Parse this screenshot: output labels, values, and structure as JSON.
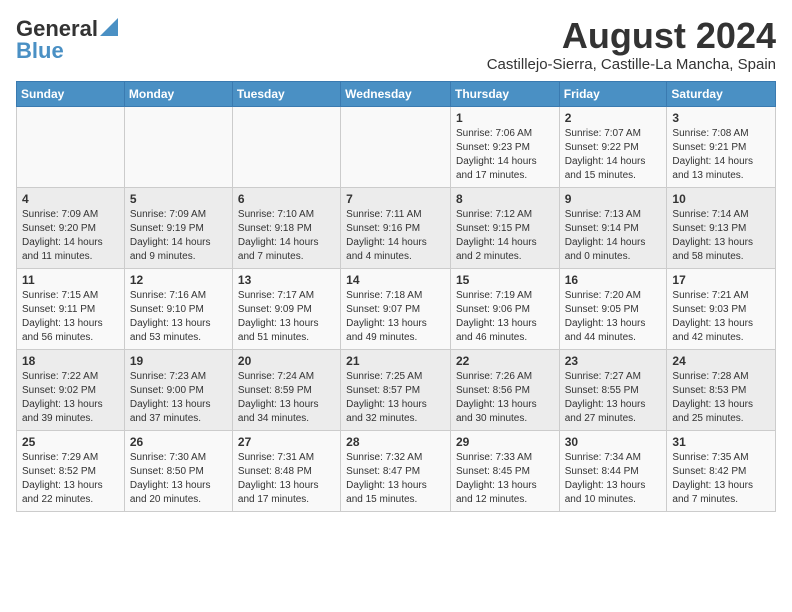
{
  "header": {
    "logo_general": "General",
    "logo_blue": "Blue",
    "month": "August 2024",
    "location": "Castillejo-Sierra, Castille-La Mancha, Spain"
  },
  "days_of_week": [
    "Sunday",
    "Monday",
    "Tuesday",
    "Wednesday",
    "Thursday",
    "Friday",
    "Saturday"
  ],
  "weeks": [
    [
      {
        "day": "",
        "info": ""
      },
      {
        "day": "",
        "info": ""
      },
      {
        "day": "",
        "info": ""
      },
      {
        "day": "",
        "info": ""
      },
      {
        "day": "1",
        "info": "Sunrise: 7:06 AM\nSunset: 9:23 PM\nDaylight: 14 hours and 17 minutes."
      },
      {
        "day": "2",
        "info": "Sunrise: 7:07 AM\nSunset: 9:22 PM\nDaylight: 14 hours and 15 minutes."
      },
      {
        "day": "3",
        "info": "Sunrise: 7:08 AM\nSunset: 9:21 PM\nDaylight: 14 hours and 13 minutes."
      }
    ],
    [
      {
        "day": "4",
        "info": "Sunrise: 7:09 AM\nSunset: 9:20 PM\nDaylight: 14 hours and 11 minutes."
      },
      {
        "day": "5",
        "info": "Sunrise: 7:09 AM\nSunset: 9:19 PM\nDaylight: 14 hours and 9 minutes."
      },
      {
        "day": "6",
        "info": "Sunrise: 7:10 AM\nSunset: 9:18 PM\nDaylight: 14 hours and 7 minutes."
      },
      {
        "day": "7",
        "info": "Sunrise: 7:11 AM\nSunset: 9:16 PM\nDaylight: 14 hours and 4 minutes."
      },
      {
        "day": "8",
        "info": "Sunrise: 7:12 AM\nSunset: 9:15 PM\nDaylight: 14 hours and 2 minutes."
      },
      {
        "day": "9",
        "info": "Sunrise: 7:13 AM\nSunset: 9:14 PM\nDaylight: 14 hours and 0 minutes."
      },
      {
        "day": "10",
        "info": "Sunrise: 7:14 AM\nSunset: 9:13 PM\nDaylight: 13 hours and 58 minutes."
      }
    ],
    [
      {
        "day": "11",
        "info": "Sunrise: 7:15 AM\nSunset: 9:11 PM\nDaylight: 13 hours and 56 minutes."
      },
      {
        "day": "12",
        "info": "Sunrise: 7:16 AM\nSunset: 9:10 PM\nDaylight: 13 hours and 53 minutes."
      },
      {
        "day": "13",
        "info": "Sunrise: 7:17 AM\nSunset: 9:09 PM\nDaylight: 13 hours and 51 minutes."
      },
      {
        "day": "14",
        "info": "Sunrise: 7:18 AM\nSunset: 9:07 PM\nDaylight: 13 hours and 49 minutes."
      },
      {
        "day": "15",
        "info": "Sunrise: 7:19 AM\nSunset: 9:06 PM\nDaylight: 13 hours and 46 minutes."
      },
      {
        "day": "16",
        "info": "Sunrise: 7:20 AM\nSunset: 9:05 PM\nDaylight: 13 hours and 44 minutes."
      },
      {
        "day": "17",
        "info": "Sunrise: 7:21 AM\nSunset: 9:03 PM\nDaylight: 13 hours and 42 minutes."
      }
    ],
    [
      {
        "day": "18",
        "info": "Sunrise: 7:22 AM\nSunset: 9:02 PM\nDaylight: 13 hours and 39 minutes."
      },
      {
        "day": "19",
        "info": "Sunrise: 7:23 AM\nSunset: 9:00 PM\nDaylight: 13 hours and 37 minutes."
      },
      {
        "day": "20",
        "info": "Sunrise: 7:24 AM\nSunset: 8:59 PM\nDaylight: 13 hours and 34 minutes."
      },
      {
        "day": "21",
        "info": "Sunrise: 7:25 AM\nSunset: 8:57 PM\nDaylight: 13 hours and 32 minutes."
      },
      {
        "day": "22",
        "info": "Sunrise: 7:26 AM\nSunset: 8:56 PM\nDaylight: 13 hours and 30 minutes."
      },
      {
        "day": "23",
        "info": "Sunrise: 7:27 AM\nSunset: 8:55 PM\nDaylight: 13 hours and 27 minutes."
      },
      {
        "day": "24",
        "info": "Sunrise: 7:28 AM\nSunset: 8:53 PM\nDaylight: 13 hours and 25 minutes."
      }
    ],
    [
      {
        "day": "25",
        "info": "Sunrise: 7:29 AM\nSunset: 8:52 PM\nDaylight: 13 hours and 22 minutes."
      },
      {
        "day": "26",
        "info": "Sunrise: 7:30 AM\nSunset: 8:50 PM\nDaylight: 13 hours and 20 minutes."
      },
      {
        "day": "27",
        "info": "Sunrise: 7:31 AM\nSunset: 8:48 PM\nDaylight: 13 hours and 17 minutes."
      },
      {
        "day": "28",
        "info": "Sunrise: 7:32 AM\nSunset: 8:47 PM\nDaylight: 13 hours and 15 minutes."
      },
      {
        "day": "29",
        "info": "Sunrise: 7:33 AM\nSunset: 8:45 PM\nDaylight: 13 hours and 12 minutes."
      },
      {
        "day": "30",
        "info": "Sunrise: 7:34 AM\nSunset: 8:44 PM\nDaylight: 13 hours and 10 minutes."
      },
      {
        "day": "31",
        "info": "Sunrise: 7:35 AM\nSunset: 8:42 PM\nDaylight: 13 hours and 7 minutes."
      }
    ]
  ]
}
